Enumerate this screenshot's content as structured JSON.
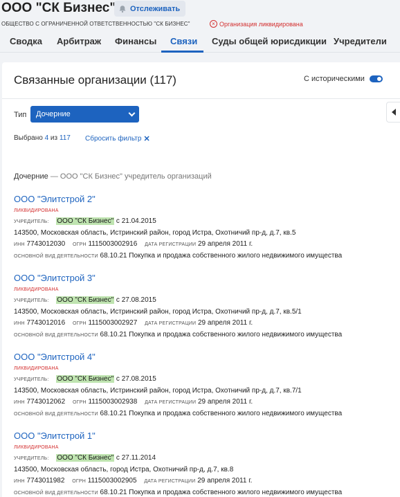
{
  "header": {
    "company_name": "ООО \"СК Бизнес\"",
    "track_label": "Отслеживать",
    "full_name": "ОБЩЕСТВО С ОГРАНИЧЕННОЙ ОТВЕТСТВЕННОСТЬЮ \"СК БИЗНЕС\"",
    "status": "Организация ликвидирована"
  },
  "tabs": [
    {
      "label": "Сводка"
    },
    {
      "label": "Арбитраж"
    },
    {
      "label": "Финансы"
    },
    {
      "label": "Связи",
      "active": true
    },
    {
      "label": "Суды общей юрисдикции"
    },
    {
      "label": "Учредители"
    }
  ],
  "panel": {
    "title": "Связанные организации (117)",
    "historical_label": "С историческими",
    "historical_on": true,
    "type_label": "Тип",
    "type_value": "Дочерние",
    "selected_prefix": "Выбрано",
    "selected_count": "4",
    "selected_of": "из",
    "selected_total": "117",
    "reset_filter": "Сбросить фильтр",
    "section_title": "Дочерние",
    "section_sub": "— ООО \"СК Бизнес\" учредитель организаций"
  },
  "labels": {
    "founder": "Учредитель:",
    "inn": "ИНН",
    "ogrn": "ОГРН",
    "reg_date": "Дата регистрации",
    "activity": "Основной вид деятельности"
  },
  "orgs": [
    {
      "name": "ООО \"Элитстрой 2\"",
      "status": "ЛИКВИДИРОВАНА",
      "founder": "ООО \"СК Бизнес\"",
      "founder_since": "с 21.04.2015",
      "address": "143500, Московская область, Истринский район, город Истра, Охотничий пр-д, д.7, кв.5",
      "inn": "7743012030",
      "ogrn": "1115003002916",
      "reg_date": "29 апреля 2011 г.",
      "activity": "68.10.21 Покупка и продажа собственного жилого недвижимого имущества"
    },
    {
      "name": "ООО \"Элитстрой 3\"",
      "status": "ЛИКВИДИРОВАНА",
      "founder": "ООО \"СК Бизнес\"",
      "founder_since": "с 27.08.2015",
      "address": "143500, Московская область, Истринский район, город Истра, Охотничий пр-д, д.7, кв.5/1",
      "inn": "7743012016",
      "ogrn": "1115003002927",
      "reg_date": "29 апреля 2011 г.",
      "activity": "68.10.21 Покупка и продажа собственного жилого недвижимого имущества"
    },
    {
      "name": "ООО \"Элитстрой 4\"",
      "status": "ЛИКВИДИРОВАНА",
      "founder": "ООО \"СК Бизнес\"",
      "founder_since": "с 27.08.2015",
      "address": "143500, Московская область, Истринский район, город Истра, Охотничий пр-д, д.7, кв.7/1",
      "inn": "7743012062",
      "ogrn": "1115003002938",
      "reg_date": "29 апреля 2011 г.",
      "activity": "68.10.21 Покупка и продажа собственного жилого недвижимого имущества"
    },
    {
      "name": "ООО \"Элитстрой 1\"",
      "status": "ЛИКВИДИРОВАНА",
      "founder": "ООО \"СК Бизнес\"",
      "founder_since": "с 27.11.2014",
      "address": "143500, Московская область, город Истра, Охотничий пр-д, д.7, кв.8",
      "inn": "7743011982",
      "ogrn": "1115003002905",
      "reg_date": "29 апреля 2011 г.",
      "activity": "68.10.21 Покупка и продажа собственного жилого недвижимого имущества"
    }
  ],
  "colors": {
    "accent": "#1d63bf",
    "danger": "#d32f2f",
    "highlight": "#bfe4b0"
  }
}
